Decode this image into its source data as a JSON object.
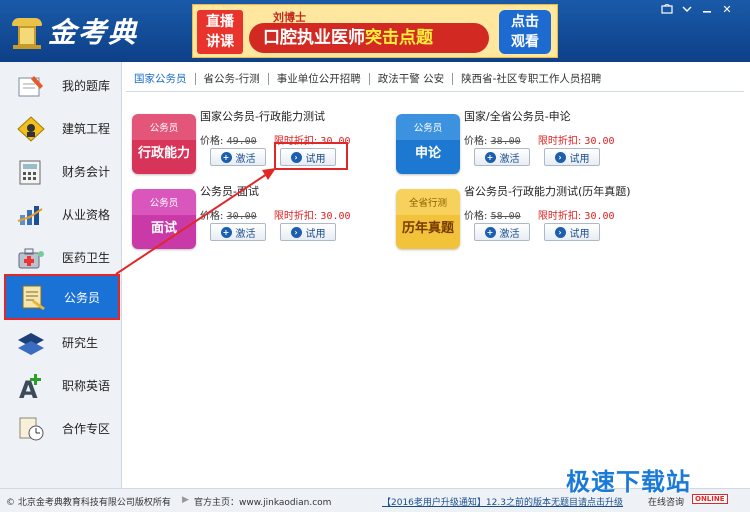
{
  "app": {
    "logo_text": "金考典"
  },
  "banner": {
    "left_line1": "直播",
    "left_line2": "讲课",
    "doctor": "刘博士",
    "main_a": "口腔执业医师",
    "main_b": "突击点题",
    "right_line1": "点击",
    "right_line2": "观看"
  },
  "window": {
    "close_label": "✕"
  },
  "sidebar": {
    "items": [
      {
        "label": "我的题库",
        "icon": "question-bank-icon"
      },
      {
        "label": "建筑工程",
        "icon": "construction-icon"
      },
      {
        "label": "财务会计",
        "icon": "accounting-icon"
      },
      {
        "label": "从业资格",
        "icon": "qualification-icon"
      },
      {
        "label": "医药卫生",
        "icon": "medical-icon"
      },
      {
        "label": "公务员",
        "icon": "civil-servant-icon"
      },
      {
        "label": "研究生",
        "icon": "graduate-icon"
      },
      {
        "label": "职称英语",
        "icon": "english-icon"
      },
      {
        "label": "合作专区",
        "icon": "cooperation-icon"
      }
    ],
    "active_index": 5
  },
  "tabs": [
    "国家公务员",
    "省公务-行测",
    "事业单位公开招聘",
    "政法干警 公安",
    "陕西省-社区专职工作人员招聘"
  ],
  "products": [
    {
      "thumb_top": "公务员",
      "thumb_bottom": "行政能力",
      "name": "国家公务员-行政能力测试",
      "price_label": "价格:",
      "price": "49.00",
      "discount_label": "限时折扣:",
      "discount": "30.00",
      "activate": "激活",
      "trial": "试用"
    },
    {
      "thumb_top": "公务员",
      "thumb_bottom": "申论",
      "name": "国家/全省公务员-申论",
      "price_label": "价格:",
      "price": "38.00",
      "discount_label": "限时折扣:",
      "discount": "30.00",
      "activate": "激活",
      "trial": "试用"
    },
    {
      "thumb_top": "公务员",
      "thumb_bottom": "面试",
      "name": "公务员-面试",
      "price_label": "价格:",
      "price": "30.00",
      "discount_label": "限时折扣:",
      "discount": "30.00",
      "activate": "激活",
      "trial": "试用"
    },
    {
      "thumb_top": "全省行测",
      "thumb_bottom": "历年真题",
      "name": "省公务员-行政能力测试(历年真题)",
      "price_label": "价格:",
      "price": "58.00",
      "discount_label": "限时折扣:",
      "discount": "30.00",
      "activate": "激活",
      "trial": "试用"
    }
  ],
  "footer": {
    "copyright": "© 北京金考典教育科技有限公司版权所有",
    "site_label": "官方主页：www.jinkaodian.com",
    "notice": "【2016老用户升级通知】12.3之前的版本无题目请点击升级",
    "online": "在线咨询",
    "online_badge": "ONLINE"
  },
  "watermark": "极速下载站",
  "colors": {
    "header_blue": "#1a5aa8",
    "active_blue": "#1a72d6",
    "highlight_red": "#e12828",
    "thumb_red": "#d8345a",
    "thumb_blue": "#1d78d2",
    "thumb_magenta": "#c93aa8",
    "thumb_gold": "#f2c23a"
  }
}
